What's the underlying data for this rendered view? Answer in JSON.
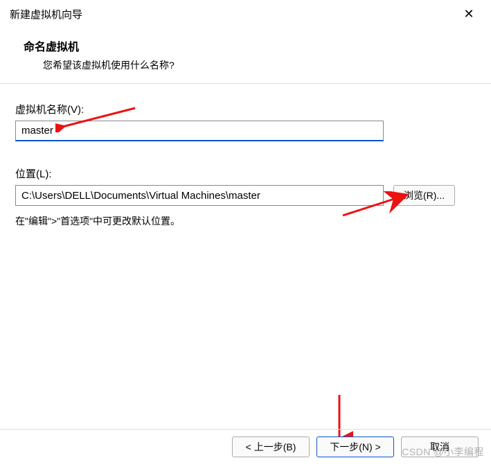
{
  "titlebar": {
    "title": "新建虚拟机向导"
  },
  "header": {
    "title": "命名虚拟机",
    "subtitle": "您希望该虚拟机使用什么名称?"
  },
  "fields": {
    "name_label": "虚拟机名称(V):",
    "name_value": "master",
    "location_label": "位置(L):",
    "location_value": "C:\\Users\\DELL\\Documents\\Virtual Machines\\master",
    "browse_label": "浏览(R)...",
    "hint": "在\"编辑\">\"首选项\"中可更改默认位置。"
  },
  "footer": {
    "back": "< 上一步(B)",
    "next": "下一步(N) >",
    "cancel": "取消"
  },
  "watermark": "CSDN @小李编程"
}
